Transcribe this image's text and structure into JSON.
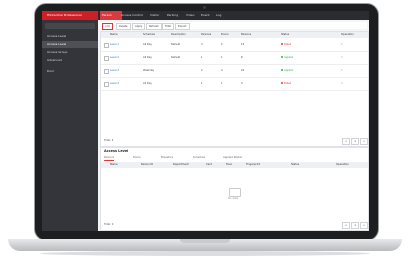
{
  "app": {
    "brand_label": "HikCentral Professional",
    "tabs": [
      "Person",
      "Access Control",
      "Visitor",
      "Parking",
      "Video",
      "Event",
      "Log"
    ]
  },
  "sidebar": {
    "items": [
      {
        "label": "Access Level",
        "selected": false
      },
      {
        "label": "Access Level",
        "selected": true
      },
      {
        "label": "Access Group",
        "selected": false
      },
      {
        "label": "Advanced",
        "selected": false
      },
      {
        "label": "Door",
        "selected": false
      }
    ]
  },
  "toolbar": {
    "add_label": "Add",
    "buttons": [
      "Delete",
      "Apply",
      "Refresh",
      "Filter",
      "Export"
    ]
  },
  "table": {
    "columns": [
      "Name",
      "Schedule",
      "Description",
      "Devices",
      "Doors",
      "Persons",
      "Status",
      "Operation"
    ],
    "rows": [
      {
        "name": "Level 1",
        "schedule": "All Day",
        "desc": "Default",
        "devices": "3",
        "doors": "2",
        "persons": "15",
        "status": "Failed",
        "status_color": "#e2383f"
      },
      {
        "name": "Level 2",
        "schedule": "All Day",
        "desc": "Default",
        "devices": "1",
        "doors": "1",
        "persons": "8",
        "status": "Applied",
        "status_color": "#2fae52"
      },
      {
        "name": "Level 3",
        "schedule": "Weekday",
        "desc": "",
        "devices": "2",
        "doors": "4",
        "persons": "22",
        "status": "Applied",
        "status_color": "#2fae52"
      },
      {
        "name": "Level 4",
        "schedule": "All Day",
        "desc": "",
        "devices": "1",
        "doors": "1",
        "persons": "3",
        "status": "Failed",
        "status_color": "#e2383f"
      }
    ],
    "pager": {
      "total": "Total: 4",
      "pages": [
        "<",
        "1",
        ">"
      ]
    }
  },
  "detail": {
    "title": "Access Level",
    "subtabs": [
      "Persons",
      "Doors",
      "Elevators",
      "Schedule",
      "Applied Status"
    ],
    "columns": [
      "Name",
      "Person ID",
      "Department",
      "Card",
      "Face",
      "Fingerprint",
      "Status",
      "Operation"
    ],
    "empty_text": "No data.",
    "pager": {
      "total": "Total: 0",
      "pages": [
        "<",
        "1",
        ">"
      ]
    }
  }
}
